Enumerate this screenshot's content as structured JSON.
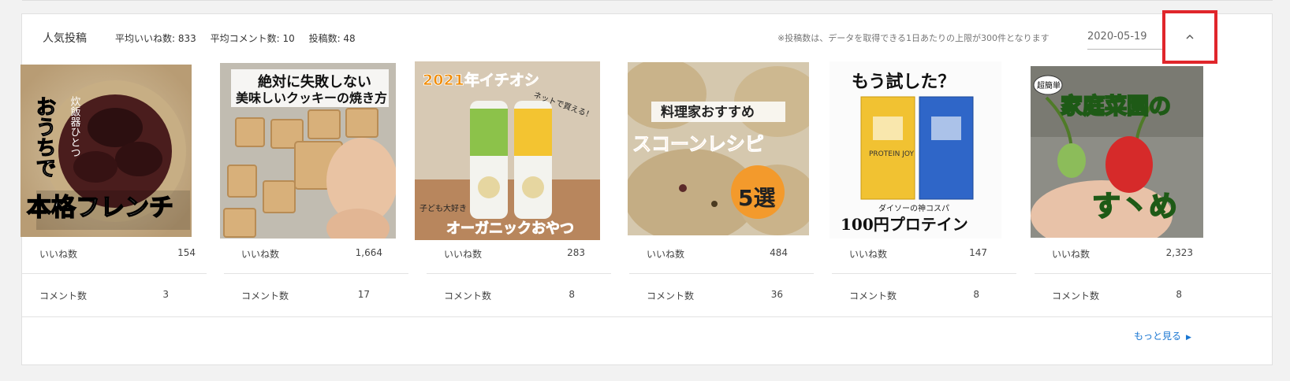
{
  "header": {
    "title": "人気投稿",
    "avg_likes": "平均いいね数: 833",
    "avg_comments": "平均コメント数: 10",
    "post_count": "投稿数: 48",
    "notice": "※投稿数は、データを取得できる1日あたりの上限が300件となります",
    "date": "2020-05-19"
  },
  "metric_labels": {
    "likes": "いいね数",
    "comments": "コメント数"
  },
  "posts": [
    {
      "likes": "154",
      "comments": "3",
      "image_text": [
        "おうちで",
        "炊飯器ひとつ",
        "本格フレンチ"
      ]
    },
    {
      "likes": "1,664",
      "comments": "17",
      "image_text": [
        "絶対に失敗しない",
        "美味しいクッキーの焼き方"
      ]
    },
    {
      "likes": "283",
      "comments": "8",
      "image_text": [
        "2021年イチオシ",
        "ネットで買える！",
        "子ども大好き",
        "オーガニックおやつ"
      ]
    },
    {
      "likes": "484",
      "comments": "36",
      "image_text": [
        "料理家おすすめ",
        "スコーンレシピ",
        "5選"
      ]
    },
    {
      "likes": "147",
      "comments": "8",
      "image_text": [
        "もう試した？",
        "PROTEIN JOY",
        "ダイソーの神コスパ",
        "100円プロテイン"
      ]
    },
    {
      "likes": "2,323",
      "comments": "8",
      "image_text": [
        "超簡単",
        "家庭菜園の",
        "す丶め"
      ]
    }
  ],
  "more_link": "もっと見る",
  "colors": {
    "accent_link": "#1976d2",
    "highlight_box": "#e0262b"
  }
}
